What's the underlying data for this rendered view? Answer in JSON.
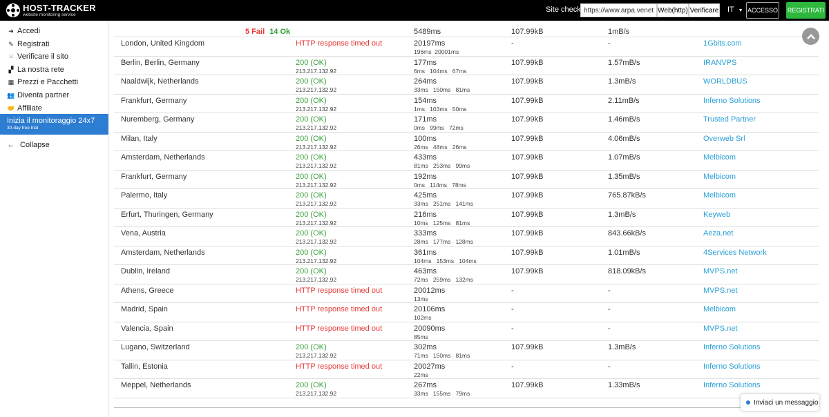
{
  "brand": {
    "title": "HOST-TRACKER",
    "subtitle": "website monitoring service"
  },
  "topbar": {
    "site_check_label": "Site check",
    "url_value": "https://www.arpa.veneto.it",
    "web_button": "Web(http)",
    "verify_button": "Verificare",
    "language": "IT",
    "login_button": "ACCESSO",
    "register_button": "REGISTRATI"
  },
  "sidebar": {
    "items": [
      {
        "label": "Accedi",
        "icon": "sign-in-icon"
      },
      {
        "label": "Registrati",
        "icon": "edit-icon"
      },
      {
        "label": "Verificare il sito",
        "icon": "spinner-icon"
      },
      {
        "label": "La nostra rete",
        "icon": "sitemap-icon"
      },
      {
        "label": "Prezzi e Pacchetti",
        "icon": "grid-icon"
      },
      {
        "label": "Diventa partner",
        "icon": "users-icon"
      },
      {
        "label": "Affiliate",
        "icon": "handshake-icon"
      }
    ],
    "cta_title": "Inizia il monitoraggio 24x7",
    "cta_sub": "30-day free trial",
    "collapse": "Collapse"
  },
  "summary": {
    "fail": "5 Fail",
    "ok": "14 Ok",
    "time": "5489ms",
    "size": "107.99kB",
    "speed": "1mB/s"
  },
  "rows": [
    {
      "location": "London, United Kingdom",
      "status": "HTTP response timed out",
      "ok": false,
      "ip": "",
      "time": "20197ms",
      "sub": "196ms  20001ms",
      "size": "-",
      "speed": "-",
      "provider": "1Gbits.com"
    },
    {
      "location": "Berlin, Berlin, Germany",
      "status": "200 (OK)",
      "ok": true,
      "ip": "213.217.132.92",
      "time": "177ms",
      "sub": "6ms   104ms   67ms",
      "size": "107.99kB",
      "speed": "1.57mB/s",
      "provider": "IRANVPS"
    },
    {
      "location": "Naaldwijk, Netherlands",
      "status": "200 (OK)",
      "ok": true,
      "ip": "213.217.132.92",
      "time": "264ms",
      "sub": "33ms   150ms   81ms",
      "size": "107.99kB",
      "speed": "1.3mB/s",
      "provider": "WORLDBUS"
    },
    {
      "location": "Frankfurt, Germany",
      "status": "200 (OK)",
      "ok": true,
      "ip": "213.217.132.92",
      "time": "154ms",
      "sub": "1ms   103ms   50ms",
      "size": "107.99kB",
      "speed": "2.11mB/s",
      "provider": "Inferno Solutions"
    },
    {
      "location": "Nuremberg, Germany",
      "status": "200 (OK)",
      "ok": true,
      "ip": "213.217.132.92",
      "time": "171ms",
      "sub": "0ms   99ms   72ms",
      "size": "107.99kB",
      "speed": "1.46mB/s",
      "provider": "Trusted Partner"
    },
    {
      "location": "Milan, Italy",
      "status": "200 (OK)",
      "ok": true,
      "ip": "213.217.132.92",
      "time": "100ms",
      "sub": "26ms   48ms   26ms",
      "size": "107.99kB",
      "speed": "4.06mB/s",
      "provider": "Overweb Srl"
    },
    {
      "location": "Amsterdam, Netherlands",
      "status": "200 (OK)",
      "ok": true,
      "ip": "213.217.132.92",
      "time": "433ms",
      "sub": "81ms   253ms   99ms",
      "size": "107.99kB",
      "speed": "1.07mB/s",
      "provider": "Melbicom"
    },
    {
      "location": "Frankfurt, Germany",
      "status": "200 (OK)",
      "ok": true,
      "ip": "213.217.132.92",
      "time": "192ms",
      "sub": "0ms   114ms   78ms",
      "size": "107.99kB",
      "speed": "1.35mB/s",
      "provider": "Melbicom"
    },
    {
      "location": "Palermo, Italy",
      "status": "200 (OK)",
      "ok": true,
      "ip": "213.217.132.92",
      "time": "425ms",
      "sub": "33ms   251ms   141ms",
      "size": "107.99kB",
      "speed": "765.87kB/s",
      "provider": "Melbicom"
    },
    {
      "location": "Erfurt, Thuringen, Germany",
      "status": "200 (OK)",
      "ok": true,
      "ip": "213.217.132.92",
      "time": "216ms",
      "sub": "10ms   125ms   81ms",
      "size": "107.99kB",
      "speed": "1.3mB/s",
      "provider": "Keyweb"
    },
    {
      "location": "Vena, Austria",
      "status": "200 (OK)",
      "ok": true,
      "ip": "213.217.132.92",
      "time": "333ms",
      "sub": "28ms   177ms   128ms",
      "size": "107.99kB",
      "speed": "843.66kB/s",
      "provider": "Aeza.net"
    },
    {
      "location": "Amsterdam, Netherlands",
      "status": "200 (OK)",
      "ok": true,
      "ip": "213.217.132.92",
      "time": "361ms",
      "sub": "104ms   153ms   104ms",
      "size": "107.99kB",
      "speed": "1.01mB/s",
      "provider": "4Services Network"
    },
    {
      "location": "Dublin, Ireland",
      "status": "200 (OK)",
      "ok": true,
      "ip": "213.217.132.92",
      "time": "463ms",
      "sub": "72ms   259ms   132ms",
      "size": "107.99kB",
      "speed": "818.09kB/s",
      "provider": "MVPS.net"
    },
    {
      "location": "Athens, Greece",
      "status": "HTTP response timed out",
      "ok": false,
      "ip": "",
      "time": "20012ms",
      "sub": "13ms",
      "size": "-",
      "speed": "-",
      "provider": "MVPS.net"
    },
    {
      "location": "Madrid, Spain",
      "status": "HTTP response timed out",
      "ok": false,
      "ip": "",
      "time": "20106ms",
      "sub": "102ms",
      "size": "-",
      "speed": "-",
      "provider": "Melbicom"
    },
    {
      "location": "Valencia, Spain",
      "status": "HTTP response timed out",
      "ok": false,
      "ip": "",
      "time": "20090ms",
      "sub": "85ms",
      "size": "-",
      "speed": "-",
      "provider": "MVPS.net"
    },
    {
      "location": "Lugano, Switzerland",
      "status": "200 (OK)",
      "ok": true,
      "ip": "213.217.132.92",
      "time": "302ms",
      "sub": "71ms   150ms   81ms",
      "size": "107.99kB",
      "speed": "1.3mB/s",
      "provider": "Inferno Solutions"
    },
    {
      "location": "Tallin, Estonia",
      "status": "HTTP response timed out",
      "ok": false,
      "ip": "",
      "time": "20027ms",
      "sub": "22ms",
      "size": "-",
      "speed": "-",
      "provider": "Inferno Solutions"
    },
    {
      "location": "Meppel, Netherlands",
      "status": "200 (OK)",
      "ok": true,
      "ip": "213.217.132.92",
      "time": "267ms",
      "sub": "33ms   155ms   79ms",
      "size": "107.99kB",
      "speed": "1.33mB/s",
      "provider": "Inferno Solutions"
    }
  ],
  "chat_label": "Inviaci un messaggio",
  "colors": {
    "ok": "#3fa23f",
    "error": "#e53935",
    "link": "#2a9fd6",
    "accent": "#2d7dd2",
    "register": "#2db83d"
  }
}
